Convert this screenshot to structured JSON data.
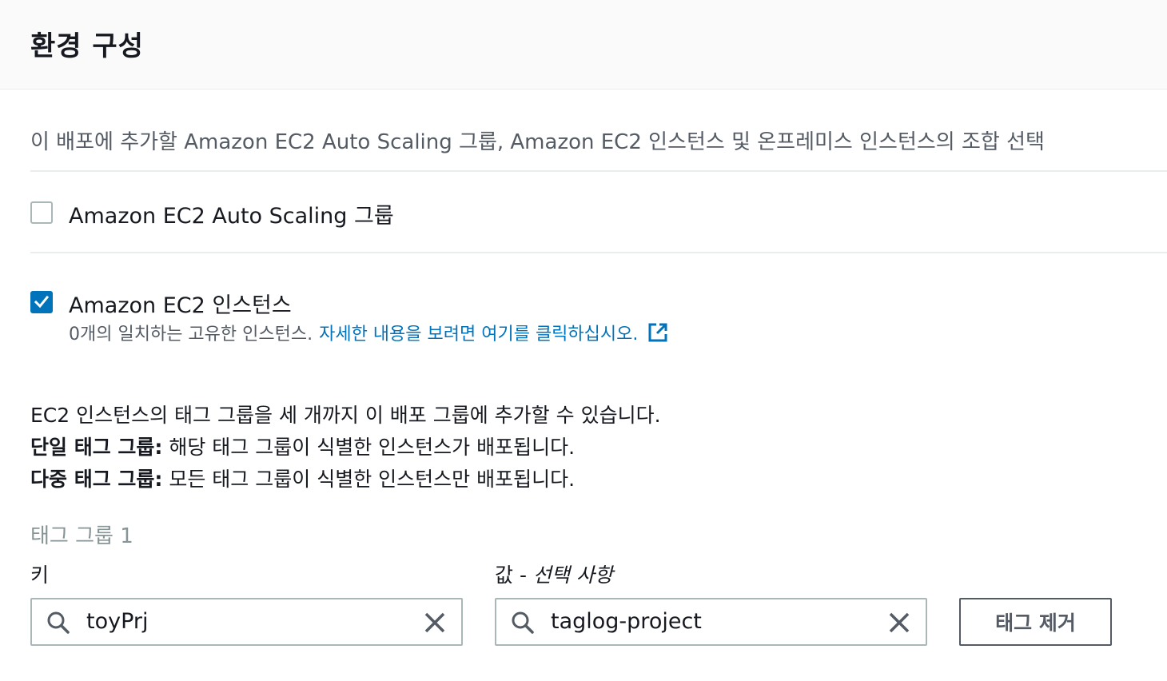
{
  "header": {
    "title": "환경 구성"
  },
  "description": "이 배포에 추가할 Amazon EC2 Auto Scaling 그룹, Amazon EC2 인스턴스 및 온프레미스 인스턴스의 조합 선택",
  "options": [
    {
      "label": "Amazon EC2 Auto Scaling 그룹",
      "checked": false
    },
    {
      "label": "Amazon EC2 인스턴스",
      "checked": true,
      "sub_text": "0개의 일치하는 고유한 인스턴스.",
      "sub_link": "자세한 내용을 보려면 여기를 클릭하십시오."
    }
  ],
  "info": {
    "line1": "EC2 인스턴스의 태그 그룹을 세 개까지 이 배포 그룹에 추가할 수 있습니다.",
    "single_bold": "단일 태그 그룹:",
    "single_text": " 해당 태그 그룹이 식별한 인스턴스가 배포됩니다.",
    "multi_bold": "다중 태그 그룹:",
    "multi_text": " 모든 태그 그룹이 식별한 인스턴스만 배포됩니다."
  },
  "tag_group": {
    "title": "태그 그룹 1",
    "key_label": "키",
    "value_label": "값 - ",
    "value_optional": "선택 사항",
    "key_value": "toyPrj",
    "value_value": "taglog-project",
    "remove_label": "태그 제거"
  },
  "colors": {
    "accent": "#0073bb",
    "text": "#16191f",
    "muted": "#545b64",
    "border": "#aab7b8"
  }
}
